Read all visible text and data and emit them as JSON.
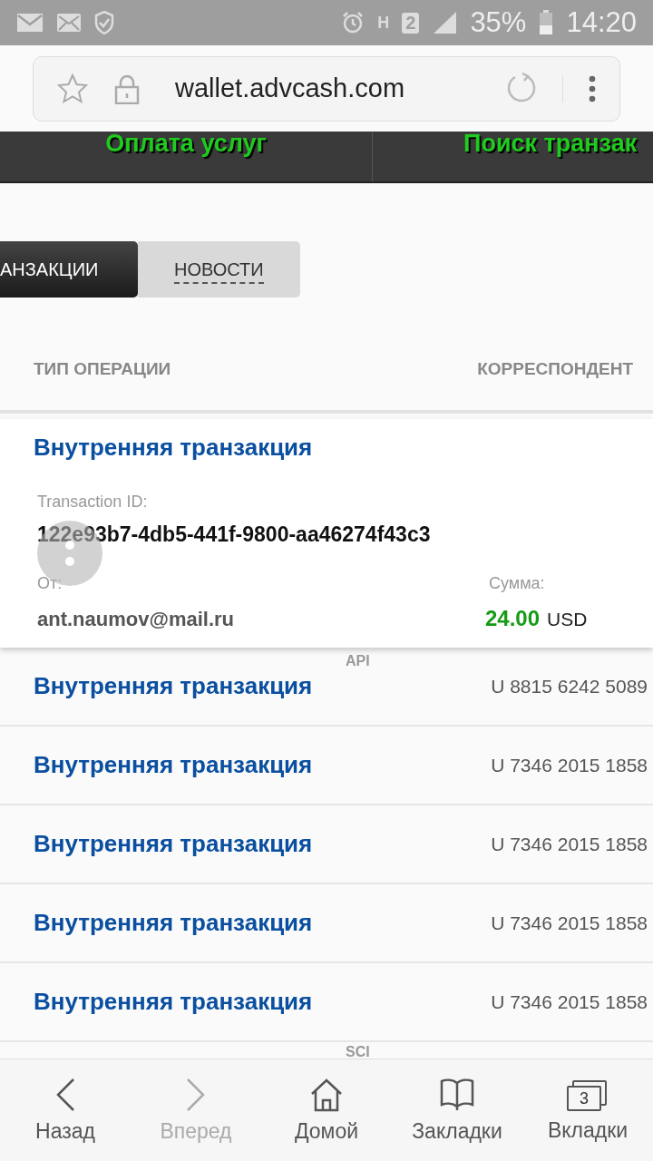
{
  "status_bar": {
    "network": "H",
    "sim": "2",
    "battery": "35%",
    "time": "14:20"
  },
  "address_bar": {
    "url": "wallet.advcash.com"
  },
  "menu": [
    {
      "label": "Оплата услуг"
    },
    {
      "label": "Поиск транзак"
    }
  ],
  "tabs": [
    {
      "label": "АНЗАКЦИИ",
      "selected": true
    },
    {
      "label": "НОВОСТИ",
      "selected": false
    }
  ],
  "table": {
    "columns": [
      "ТИП ОПЕРАЦИИ",
      "КОРРЕСПОНДЕНТ"
    ],
    "expanded": {
      "title": "Внутренняя транзакция",
      "id_label": "Transaction ID:",
      "id": "122e93b7-4db5-441f-9800-aa46274f43c3",
      "from_label": "От:",
      "from": "ant.naumov@mail.ru",
      "amount_label": "Сумма:",
      "amount": "24.00",
      "currency": "USD"
    },
    "rows": [
      {
        "title": "Внутренняя транзакция",
        "tag": "API",
        "correspondent": "U 8815 6242 5089"
      },
      {
        "title": "Внутренняя транзакция",
        "correspondent": "U 7346 2015 1858"
      },
      {
        "title": "Внутренняя транзакция",
        "correspondent": "U 7346 2015 1858"
      },
      {
        "title": "Внутренняя транзакция",
        "correspondent": "U 7346 2015 1858"
      },
      {
        "title": "Внутренняя транзакция",
        "correspondent": "U 7346 2015 1858"
      },
      {
        "tag": "SCI"
      }
    ]
  },
  "bottom_nav": [
    {
      "kind": "back",
      "label": "Назад",
      "disabled": false
    },
    {
      "kind": "forward",
      "label": "Вперед",
      "disabled": true
    },
    {
      "kind": "home",
      "label": "Домой",
      "disabled": false
    },
    {
      "kind": "bookmarks",
      "label": "Закладки",
      "disabled": false
    },
    {
      "kind": "tabs",
      "label": "Вкладки",
      "count": "3",
      "disabled": false
    }
  ]
}
